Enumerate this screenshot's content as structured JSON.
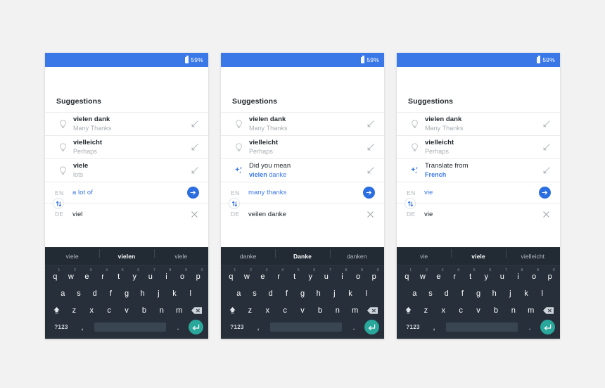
{
  "statusbar": {
    "battery_pct": "59%",
    "battery_icon": "battery-icon"
  },
  "app": {
    "suggestions_heading": "Suggestions"
  },
  "icons": {
    "lightbulb": "lightbulb-icon",
    "sparkle": "sparkle-icon",
    "insert_arrow": "arrow-down-left-icon",
    "send": "arrow-right-icon",
    "clear": "close-icon",
    "swap": "swap-vertical-icon",
    "shift": "shift-icon",
    "backspace": "backspace-icon",
    "enter": "enter-icon"
  },
  "colors": {
    "status_blue": "#3b78e7",
    "accent_blue": "#2b6ee0",
    "link_blue": "#3b78e7",
    "keyboard_bg": "#262f3a",
    "keyboard_strip_bg": "#222a34",
    "enter_teal": "#2aa79b",
    "page_bg": "#f2f2f2",
    "panel_bg": "#ffffff",
    "muted_text": "#a9aeb3"
  },
  "keyboard": {
    "row1": [
      {
        "letter": "q",
        "num": "1"
      },
      {
        "letter": "w",
        "num": "2"
      },
      {
        "letter": "e",
        "num": "3"
      },
      {
        "letter": "r",
        "num": "4"
      },
      {
        "letter": "t",
        "num": "5"
      },
      {
        "letter": "y",
        "num": "6"
      },
      {
        "letter": "u",
        "num": "7"
      },
      {
        "letter": "i",
        "num": "8"
      },
      {
        "letter": "o",
        "num": "9"
      },
      {
        "letter": "p",
        "num": "0"
      }
    ],
    "row2": [
      "a",
      "s",
      "d",
      "f",
      "g",
      "h",
      "j",
      "k",
      "l"
    ],
    "row3": [
      "z",
      "x",
      "c",
      "v",
      "b",
      "n",
      "m"
    ],
    "row4": {
      "symbols": "?123",
      "comma": ",",
      "period": ".",
      "space": ""
    }
  },
  "panels": [
    {
      "id": "panel-1",
      "suggestions": [
        {
          "icon": "lightbulb",
          "main": "vielen dank",
          "sub": "Many Thanks",
          "sub_style": "muted",
          "main_bold": true
        },
        {
          "icon": "lightbulb",
          "main": "vielleicht",
          "sub": "Perhaps",
          "sub_style": "muted",
          "main_bold": true
        },
        {
          "icon": "lightbulb",
          "main": "viele",
          "sub": "lots",
          "sub_style": "muted",
          "main_bold": true
        }
      ],
      "translate": {
        "source_lang": "EN",
        "source_text": "a lot of",
        "target_lang": "DE",
        "target_text": "viel"
      },
      "kb_strip": [
        {
          "label": "viele",
          "active": false
        },
        {
          "label": "vielen",
          "active": true
        },
        {
          "label": "viele",
          "active": false
        }
      ]
    },
    {
      "id": "panel-2",
      "suggestions": [
        {
          "icon": "lightbulb",
          "main": "vielen dank",
          "sub": "Many Thanks",
          "sub_style": "muted",
          "main_bold": true
        },
        {
          "icon": "lightbulb",
          "main": "vielleicht",
          "sub": "Perhaps",
          "sub_style": "muted",
          "main_bold": true
        },
        {
          "icon": "sparkle",
          "main": "Did you mean",
          "sub": "vielen danke",
          "sub_style": "blue",
          "sub_bold_prefix": "vielen",
          "sub_rest": " danke",
          "main_bold": false
        }
      ],
      "translate": {
        "source_lang": "EN",
        "source_text": "many thanks",
        "target_lang": "DE",
        "target_text": "veilen danke"
      },
      "kb_strip": [
        {
          "label": "danke",
          "active": false
        },
        {
          "label": "Danke",
          "active": true
        },
        {
          "label": "danken",
          "active": false
        }
      ]
    },
    {
      "id": "panel-3",
      "suggestions": [
        {
          "icon": "lightbulb",
          "main": "vielen dank",
          "sub": "Many Thanks",
          "sub_style": "muted",
          "main_bold": true
        },
        {
          "icon": "lightbulb",
          "main": "vielleicht",
          "sub": "Perhaps",
          "sub_style": "muted",
          "main_bold": true
        },
        {
          "icon": "sparkle",
          "main": "Translate from",
          "sub": "French",
          "sub_style": "blue-bold",
          "main_bold": false
        }
      ],
      "translate": {
        "source_lang": "EN",
        "source_text": "vie",
        "target_lang": "DE",
        "target_text": "vie"
      },
      "kb_strip": [
        {
          "label": "vie",
          "active": false
        },
        {
          "label": "viele",
          "active": true
        },
        {
          "label": "vielleicht",
          "active": false
        }
      ]
    }
  ]
}
